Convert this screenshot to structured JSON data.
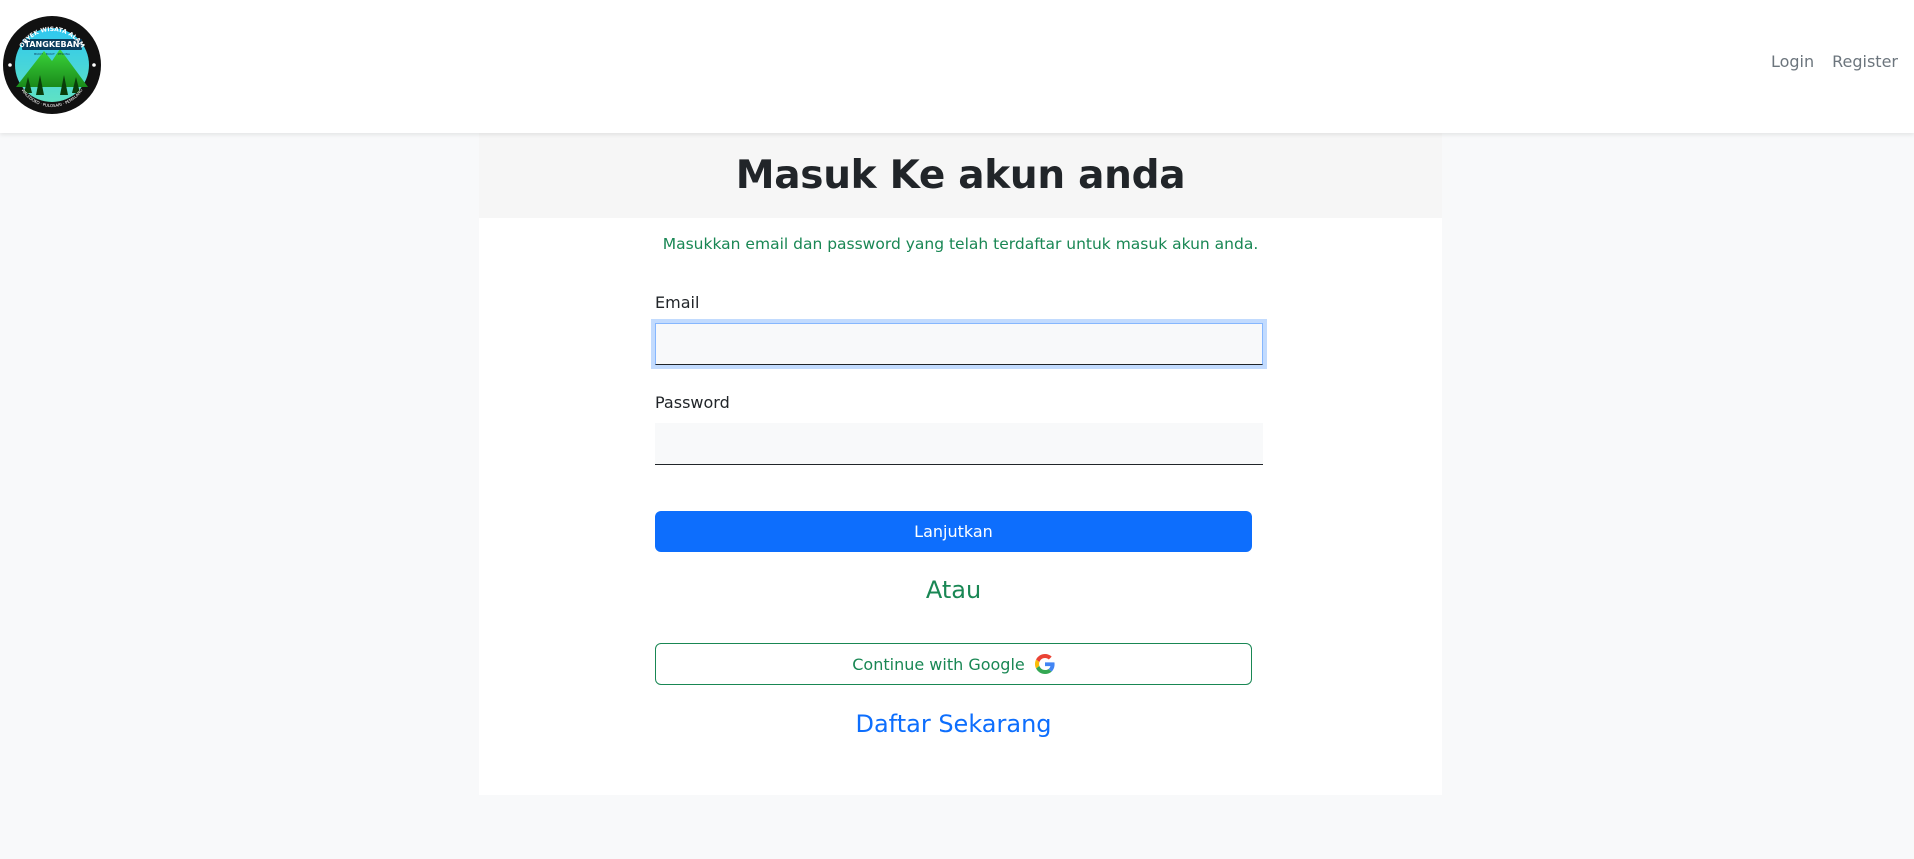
{
  "navbar": {
    "logo_text_top": "OBYEK WISATA ALAM",
    "logo_text_name": "TANGKEBAN",
    "logo_text_tagline": "BUKIT · BUKIT · PESONA",
    "logo_text_bottom": "WALEDOKO · PULOSARI · PEMALANG",
    "links": [
      {
        "label": "Login"
      },
      {
        "label": "Register"
      }
    ]
  },
  "card": {
    "title": "Masuk Ke akun anda",
    "subtitle": "Masukkan email dan password yang telah terdaftar untuk masuk akun anda.",
    "email": {
      "label": "Email",
      "value": ""
    },
    "password": {
      "label": "Password",
      "value": ""
    },
    "submit_label": "Lanjutkan",
    "divider_text": "Atau",
    "google_label": "Continue with Google",
    "register_label": "Daftar Sekarang"
  },
  "colors": {
    "primary": "#0d6efd",
    "success": "#198754",
    "background": "#f8f9fa",
    "header_band": "#f6f6f6"
  },
  "icons": [
    "brand-logo",
    "google-icon"
  ]
}
